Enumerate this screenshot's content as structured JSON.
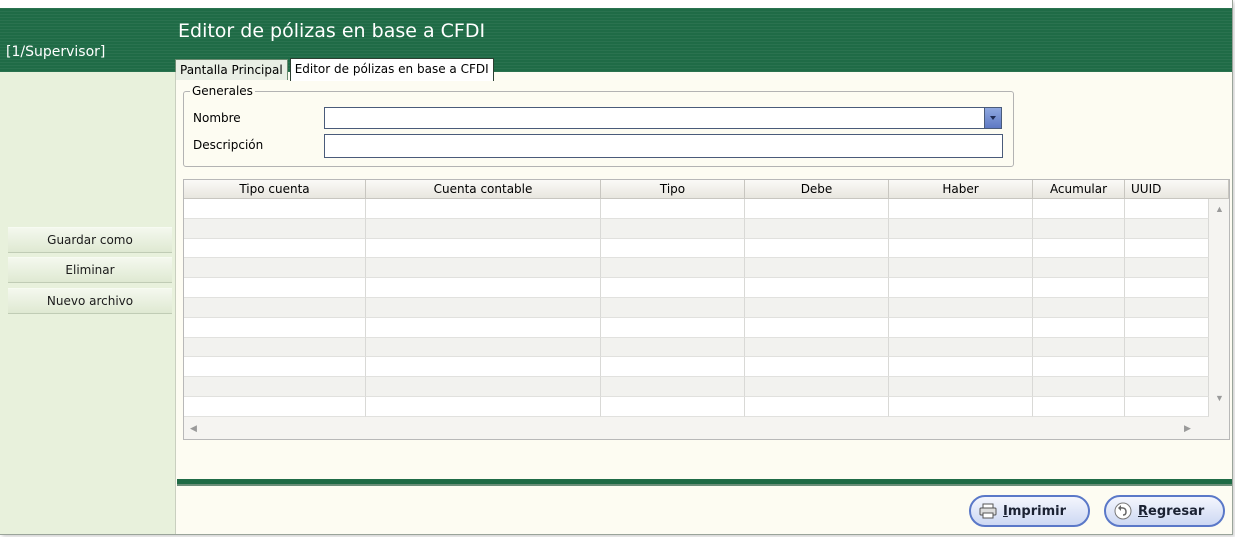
{
  "header": {
    "user": "[1/Supervisor]",
    "title": "Editor de pólizas en base a CFDI",
    "tabs": [
      {
        "label": "Pantalla Principal",
        "active": false
      },
      {
        "label": "Editor de pólizas en base a CFDI",
        "active": true
      }
    ]
  },
  "sidebar": {
    "buttons": [
      "Guardar como",
      "Eliminar",
      "Nuevo archivo"
    ]
  },
  "generales": {
    "legend": "Generales",
    "nombre_label": "Nombre",
    "nombre_value": "",
    "descripcion_label": "Descripción",
    "descripcion_value": ""
  },
  "grid": {
    "columns": [
      "Tipo cuenta",
      "Cuenta contable",
      "Tipo",
      "Debe",
      "Haber",
      "Acumular",
      "UUID"
    ],
    "row_count": 11
  },
  "footer": {
    "print_label": "Imprimir",
    "back_label": "Regresar"
  },
  "colors": {
    "header_green": "#1f6b46",
    "sidebar_bg": "#e8f1dc",
    "button_border_blue": "#5a78c8"
  }
}
